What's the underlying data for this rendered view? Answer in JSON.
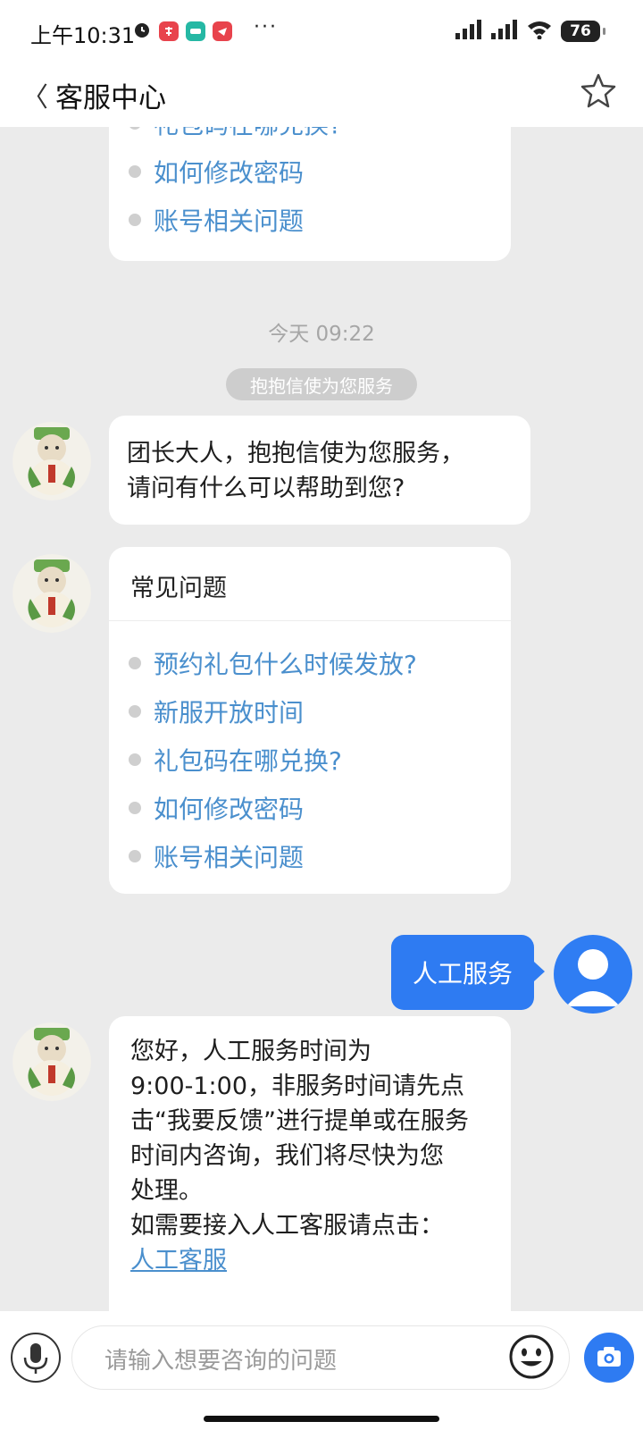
{
  "status_bar": {
    "time": "上午10:31",
    "more": "···",
    "battery": "76"
  },
  "nav": {
    "back": "〈",
    "title": "客服中心"
  },
  "top_card": {
    "items": [
      "礼包码在哪兑换?",
      "如何修改密码",
      "账号相关问题"
    ]
  },
  "timestamp": "今天 09:22",
  "system_chip": "抱抱信使为您服务",
  "greeting": {
    "line1": "团长大人，抱抱信使为您服务，",
    "line2": "请问有什么可以帮助到您?"
  },
  "faq": {
    "header": "常见问题",
    "items": [
      "预约礼包什么时候发放?",
      "新服开放时间",
      "礼包码在哪兑换?",
      "如何修改密码",
      "账号相关问题"
    ]
  },
  "user_message": "人工服务",
  "service_reply": {
    "lines": [
      "您好，人工服务时间为",
      "9:00-1:00，非服务时间请先点",
      "击“我要反馈”进行提单或在服务",
      "时间内咨询，我们将尽快为您",
      "处理。",
      "如需要接入人工客服请点击："
    ],
    "link": "人工客服"
  },
  "input": {
    "placeholder": "请输入想要咨询的问题"
  },
  "colors": {
    "accent": "#2e7bf2",
    "link": "#4a8fcd",
    "background": "#ebebeb"
  },
  "icons": {
    "back": "chevron-left-icon",
    "favorite": "star-icon",
    "voice": "microphone-icon",
    "emoji": "smiley-icon",
    "photo": "camera-icon"
  }
}
